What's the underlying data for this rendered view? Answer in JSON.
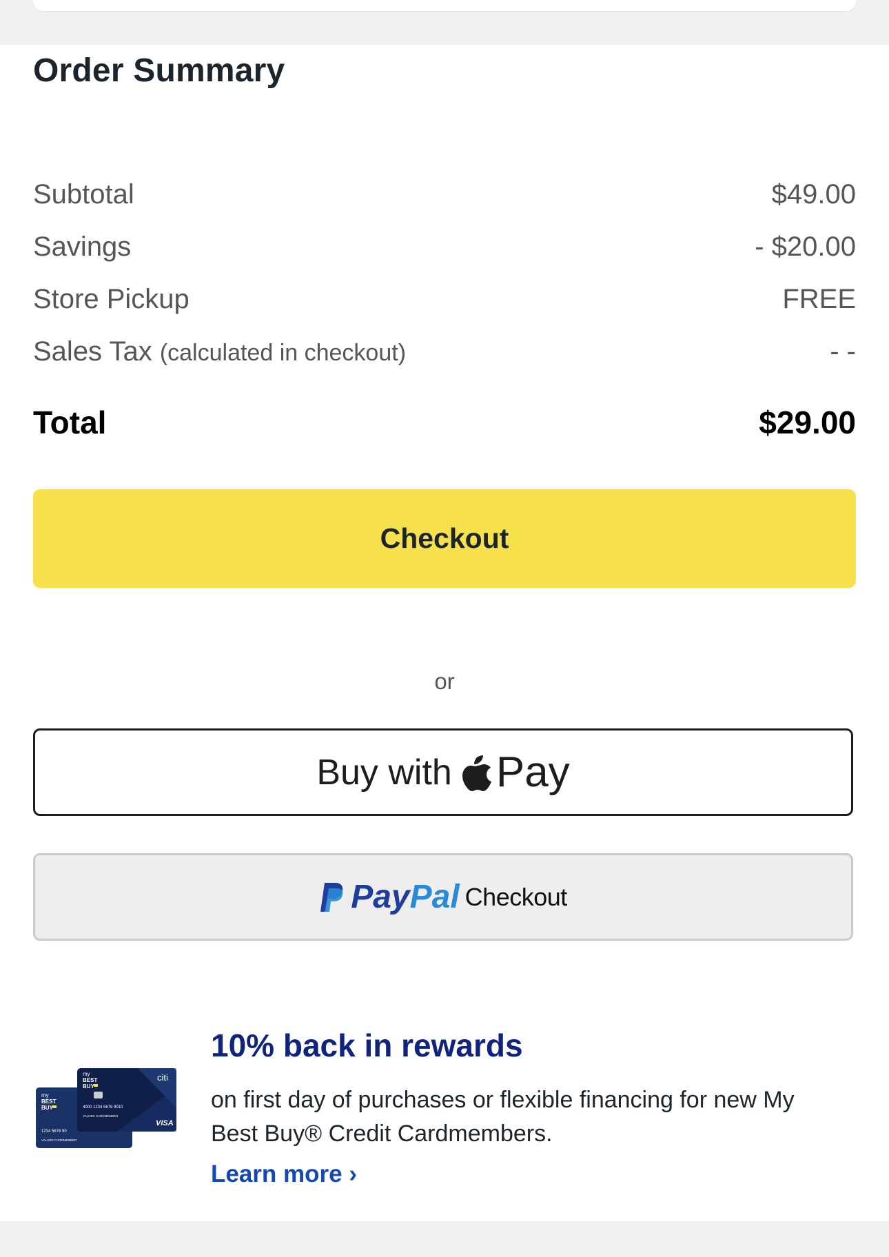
{
  "order_summary": {
    "title": "Order Summary",
    "rows": [
      {
        "label": "Subtotal",
        "value": "$49.00"
      },
      {
        "label": "Savings",
        "value": "- $20.00"
      },
      {
        "label": "Store Pickup",
        "value": "FREE"
      },
      {
        "label": "Sales Tax",
        "note": "(calculated in checkout)",
        "value": "- -"
      }
    ],
    "total": {
      "label": "Total",
      "value": "$29.00"
    }
  },
  "actions": {
    "checkout_label": "Checkout",
    "or_label": "or",
    "apple_pay": {
      "prefix": "Buy with",
      "brand": "Pay",
      "icon": "apple-icon"
    },
    "paypal": {
      "brand_pay": "Pay",
      "brand_pal": "Pal",
      "suffix": "Checkout",
      "icon": "paypal-icon"
    }
  },
  "promo": {
    "title": "10% back in rewards",
    "text": "on first day of purchases or flexible financing for new My Best Buy® Credit Cardmembers.",
    "link": "Learn more ›",
    "image": "credit-card-image",
    "card_front": {
      "brand_top": "my",
      "brand_mid": "BEST",
      "brand_bot": "BUY",
      "issuer": "citi",
      "number": "4000 1234 5678 9010",
      "holder": "VALUED CARDMEMBER",
      "network": "VISA"
    },
    "card_back": {
      "brand_top": "my",
      "brand_mid": "BEST",
      "brand_bot": "BUY",
      "number": "1234 5678 90",
      "holder": "VALUED CARDMEMBER"
    }
  },
  "colors": {
    "checkout_button": "#f6e04b",
    "promo_title": "#10237e",
    "link": "#1548b7",
    "paypal_dark": "#1f3d9a",
    "paypal_light": "#2a8ad6"
  }
}
